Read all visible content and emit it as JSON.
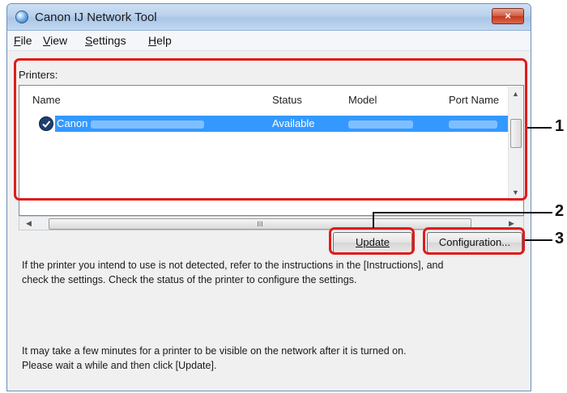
{
  "window": {
    "title": "Canon IJ Network Tool",
    "close_label": "×"
  },
  "menu": [
    {
      "accel": "F",
      "rest": "ile"
    },
    {
      "accel": "V",
      "rest": "iew"
    },
    {
      "accel": "S",
      "rest": "ettings"
    },
    {
      "accel": "H",
      "rest": "elp"
    }
  ],
  "printers": {
    "label": "Printers:",
    "columns": [
      "Name",
      "Status",
      "Model",
      "Port Name"
    ],
    "rows": [
      {
        "name": "Canon",
        "status": "Available",
        "selected": true
      }
    ],
    "hscroll_grip": "III"
  },
  "buttons": {
    "update": "Update",
    "configuration": "Configuration..."
  },
  "messages": {
    "not_detected_line1": "If the printer you intend to use is not detected, refer to the instructions in the [Instructions], and",
    "not_detected_line2": "check the settings. Check the status of the printer to configure the settings.",
    "wait_line1": "It may take a few minutes for a printer to be visible on the network after it is turned on.",
    "wait_line2": "Please wait a while and then click [Update]."
  },
  "callouts": [
    "1",
    "2",
    "3"
  ],
  "colors": {
    "callout": "#e01b1b",
    "selection": "#3399ff"
  }
}
